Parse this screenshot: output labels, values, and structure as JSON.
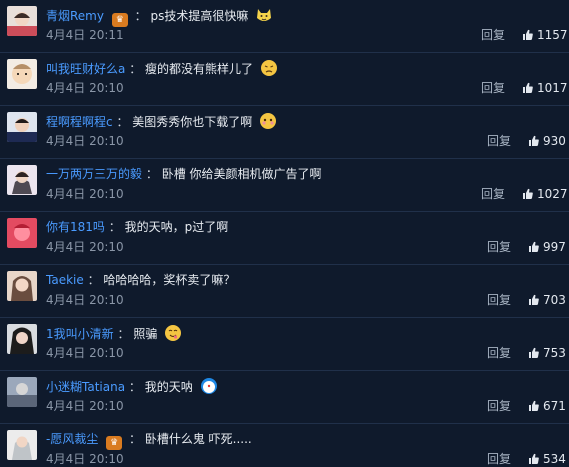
{
  "comments": [
    {
      "username": "青烟Remy",
      "sep": "：",
      "text": "ps技术提高很快嘛",
      "time": "4月4日 20:11",
      "reply": "回复",
      "likes": "1157",
      "badge": "♛",
      "emoji": "cat-face-icon"
    },
    {
      "username": "叫我旺财好么a",
      "sep": "：",
      "text": "瘦的都没有熊样儿了",
      "time": "4月4日 20:10",
      "reply": "回复",
      "likes": "1017",
      "emoji": "sad-face-icon"
    },
    {
      "username": "程啊程啊程c",
      "sep": "：",
      "text": "美图秀秀你也下载了啊",
      "time": "4月4日 20:10",
      "reply": "回复",
      "likes": "930",
      "emoji": "shy-face-icon"
    },
    {
      "username": "一万两万三万的毅",
      "sep": "：",
      "text": "卧槽 你给美颜相机做广告了啊",
      "time": "4月4日 20:10",
      "reply": "回复",
      "likes": "1027"
    },
    {
      "username": "你有181吗",
      "sep": "：",
      "text": "我的天呐，p过了啊",
      "time": "4月4日 20:10",
      "reply": "回复",
      "likes": "997"
    },
    {
      "username": "Taekie",
      "sep": "：",
      "text": "哈哈哈哈，奖杯卖了嘛？",
      "time": "4月4日 20:10",
      "reply": "回复",
      "likes": "703"
    },
    {
      "username": "1我叫小清新",
      "sep": "：",
      "text": "照骗",
      "time": "4月4日 20:10",
      "reply": "回复",
      "likes": "753",
      "emoji": "tongue-face-icon"
    },
    {
      "username": "小迷糊Tatiana",
      "sep": "：",
      "text": "我的天呐",
      "time": "4月4日 20:10",
      "reply": "回复",
      "likes": "671",
      "emoji": "doraemon-icon"
    },
    {
      "username": "-愿风裁尘",
      "sep": "：",
      "text": "卧槽什么鬼 吓死.....",
      "time": "4月4日 20:10",
      "reply": "回复",
      "likes": "534",
      "badge": "♛"
    }
  ],
  "colors": {
    "background": "#0f1a2c",
    "username": "#4a9bff",
    "timestamp": "#8a96a7",
    "badge": "#d97b20"
  }
}
